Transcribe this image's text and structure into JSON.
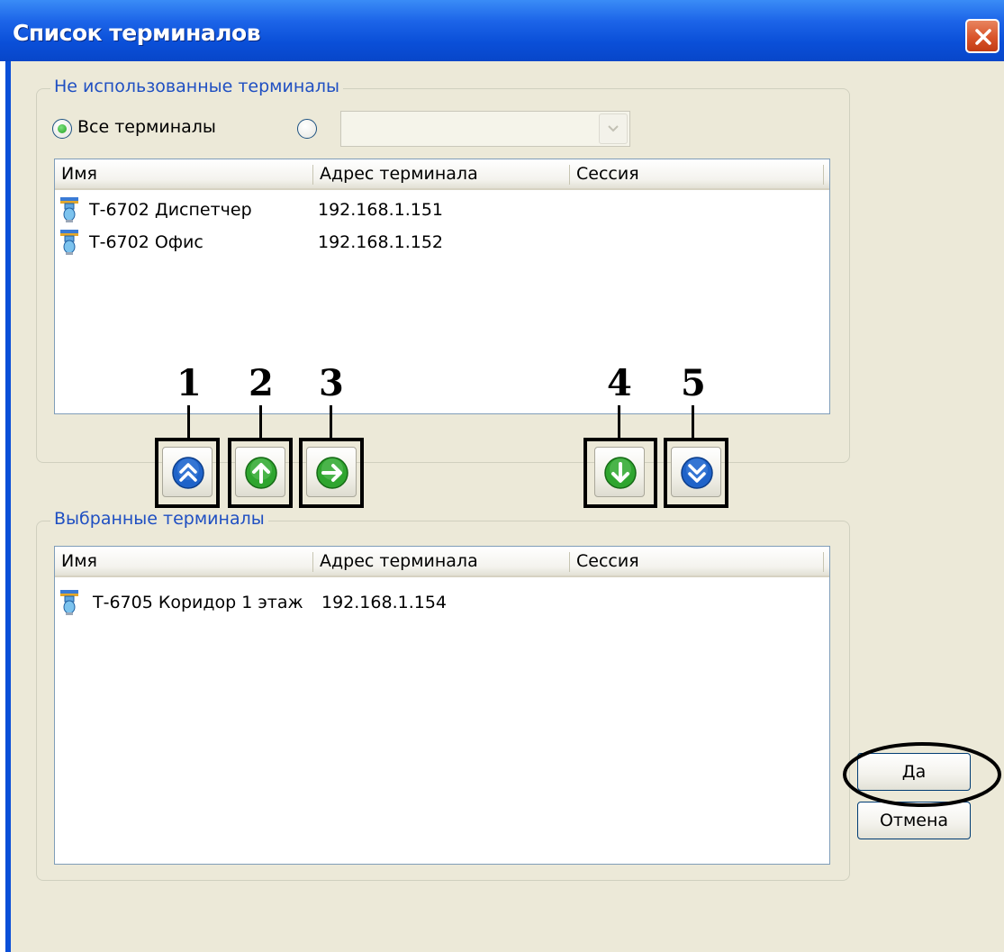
{
  "window": {
    "title": "Список терминалов",
    "close_icon": "close-icon"
  },
  "unused_group": {
    "legend": "Не использованные терминалы",
    "radio_all_label": "Все терминалы",
    "radio_all_checked": true,
    "radio_other_checked": false,
    "combo_value": "",
    "columns": [
      "Имя",
      "Адрес терминала",
      "Сессия"
    ],
    "rows": [
      {
        "icon": "terminal-icon",
        "name": "Т-6702 Диспетчер",
        "address": "192.168.1.151",
        "session": ""
      },
      {
        "icon": "terminal-icon",
        "name": "Т-6702 Офис",
        "address": "192.168.1.152",
        "session": ""
      }
    ]
  },
  "move_buttons": [
    {
      "callout": "1",
      "icon": "move-all-up-icon",
      "color": "#1f63c9"
    },
    {
      "callout": "2",
      "icon": "move-up-icon",
      "color": "#2fa52f"
    },
    {
      "callout": "3",
      "icon": "move-right-icon",
      "color": "#2fa52f"
    },
    {
      "callout": "4",
      "icon": "move-down-icon",
      "color": "#2fa52f"
    },
    {
      "callout": "5",
      "icon": "move-all-down-icon",
      "color": "#1f63c9"
    }
  ],
  "selected_group": {
    "legend": "Выбранные терминалы",
    "columns": [
      "Имя",
      "Адрес терминала",
      "Сессия"
    ],
    "rows": [
      {
        "icon": "terminal-icon",
        "name": "Т-6705 Коридор 1 этаж",
        "address": "192.168.1.154",
        "session": ""
      }
    ]
  },
  "buttons": {
    "ok_label": "Да",
    "cancel_label": "Отмена"
  },
  "colors": {
    "title_bar": "#0a4fd8",
    "client_bg": "#ece9d8",
    "legend_text": "#1f4fc2",
    "close_button": "#d9542a"
  }
}
